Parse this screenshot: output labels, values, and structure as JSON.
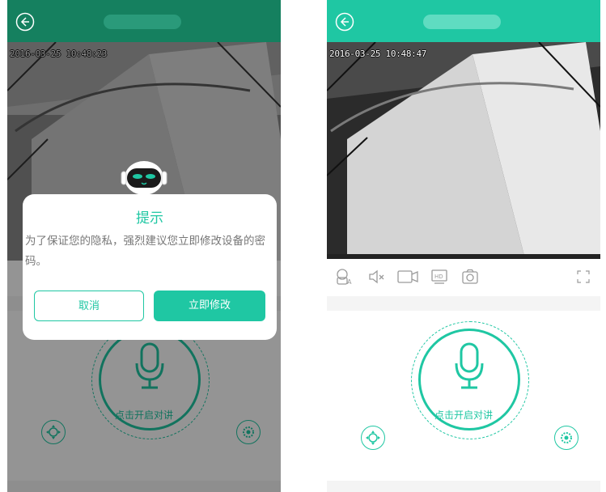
{
  "colors": {
    "accent": "#1fc7a3",
    "header_dark": "#15805f",
    "header_light": "#1fc7a3"
  },
  "left_screen": {
    "timestamp": "2016-03-25 10:48:23",
    "dialog": {
      "title": "提示",
      "message": "为了保证您的隐私，强烈建议您立即修改设备的密码。",
      "cancel_label": "取消",
      "confirm_label": "立即修改"
    },
    "talk_label": "点击开启对讲"
  },
  "right_screen": {
    "timestamp": "2016-03-25 10:48:47",
    "talk_label": "点击开启对讲",
    "toolbar_icons": [
      "voice-change-icon",
      "mute-icon",
      "record-video-icon",
      "hd-icon",
      "snapshot-icon",
      "fullscreen-icon"
    ]
  }
}
